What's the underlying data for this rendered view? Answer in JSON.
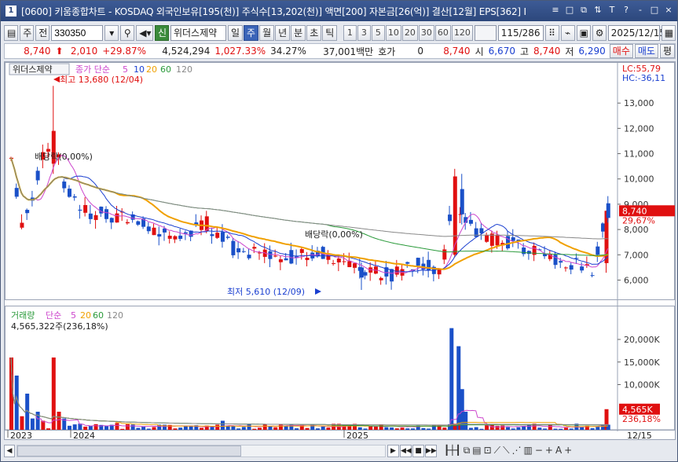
{
  "window": {
    "number": "1",
    "title": "[0600] 키움종합차트 - KOSDAQ 외국인보유[195(천)] 주식수[13,202(천)] 액면[200] 자본금[26(억)] 결산[12월] EPS[362] I",
    "controls": [
      "≡",
      "□",
      "⧉",
      "⇅",
      "T",
      "?",
      "-",
      "□",
      "×"
    ]
  },
  "toolbar": {
    "type_label": "주",
    "prev_label": "전",
    "code": "330350",
    "name": "위더스제약",
    "credit_label": "신",
    "periods": [
      "일",
      "주",
      "월",
      "년",
      "분",
      "초",
      "틱"
    ],
    "selected_period": "주",
    "intervals": [
      "1",
      "3",
      "5",
      "10",
      "20",
      "30",
      "60",
      "120"
    ],
    "count": "115/286",
    "date": "2025/12/15"
  },
  "quote": {
    "price": "8,740",
    "change": "2,010",
    "change_rate": "+29.87%",
    "volume": "4,524,294",
    "volume_rate": "1,027.33%",
    "turnover": "34.27%",
    "amount": "37,001백만",
    "hoga_label": "호가",
    "hoga_value": "0",
    "hoga_price": "8,740",
    "open_label": "시",
    "open": "6,670",
    "high_label": "고",
    "high": "8,740",
    "low_label": "저",
    "low": "6,290",
    "buy_label": "매수",
    "sell_label": "매도",
    "eval_label": "평"
  },
  "price_chart": {
    "stock_name": "위더스제약",
    "ma_label": "종가 단순",
    "ma_periods": [
      "5",
      "10",
      "20",
      "60",
      "120"
    ],
    "ma_colors": [
      "#cc44cc",
      "#1a3fd0",
      "#f0a000",
      "#2a9a3a",
      "#888888"
    ],
    "high_note": "최고 13,680 (12/04)",
    "low_note": "최저 5,610 (12/09)",
    "dividend_note_1": "배당락(0,00%)",
    "dividend_note_2": "배당락(0,00%)",
    "lc": "LC:55,79",
    "hc": "HC:-36,11",
    "price_tag": "8,740",
    "rate_tag": "29,67%",
    "y_ticks": [
      "13,000",
      "12,000",
      "11,000",
      "10,000",
      "9,000",
      "8,000",
      "7,000",
      "6,000"
    ]
  },
  "volume_chart": {
    "label": "거래량",
    "ma_label": "단순",
    "ma_periods": [
      "5",
      "20",
      "60",
      "120"
    ],
    "current": "4,565,322주(236,18%)",
    "tag_value": "4,565K",
    "tag_rate": "236,18%",
    "y_ticks": [
      "20,000K",
      "15,000K",
      "10,000K"
    ]
  },
  "x_axis": {
    "labels": [
      "2023",
      "2024",
      "2025"
    ],
    "last_date": "12/15"
  },
  "chart_data": {
    "type": "candlestick",
    "y_range": [
      5300,
      14000
    ],
    "volume_range_k": [
      0,
      24000
    ],
    "candles_weekly_sample": [
      {
        "open": 10500,
        "high": 13680,
        "low": 7500,
        "close": 11000
      },
      {
        "open": 7000,
        "high": 7500,
        "low": 6500,
        "close": 7200
      },
      {
        "open": 6400,
        "high": 6800,
        "low": 5610,
        "close": 6100
      },
      {
        "open": 6670,
        "high": 8740,
        "low": 6290,
        "close": 8740
      }
    ],
    "recent_volume_k": [
      22500,
      18500,
      4565
    ]
  }
}
